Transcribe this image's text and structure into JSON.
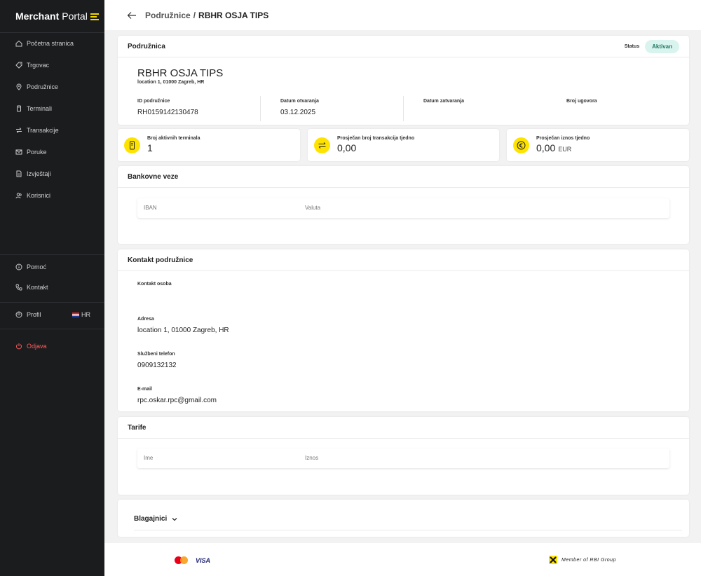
{
  "app": {
    "brand_bold": "Merchant",
    "brand_light": "Portal"
  },
  "sidebar": {
    "items": [
      {
        "label": "Početna stranica",
        "icon": "home-icon"
      },
      {
        "label": "Trgovac",
        "icon": "tag-icon"
      },
      {
        "label": "Podružnice",
        "icon": "location-pin-icon"
      },
      {
        "label": "Terminali",
        "icon": "terminal-icon"
      },
      {
        "label": "Transakcije",
        "icon": "transactions-icon"
      },
      {
        "label": "Poruke",
        "icon": "mail-icon"
      },
      {
        "label": "Izvještaji",
        "icon": "report-icon"
      },
      {
        "label": "Korisnici",
        "icon": "users-icon"
      }
    ],
    "help": "Pomoć",
    "contact": "Kontakt",
    "profile": "Profil",
    "language": "HR",
    "logout": "Odjava"
  },
  "breadcrumb": {
    "parent": "Podružnice",
    "separator": "/",
    "current": "RBHR OSJA TIPS"
  },
  "branch": {
    "section_title": "Podružnica",
    "status_label": "Status",
    "status_value": "Aktivan",
    "name": "RBHR OSJA TIPS",
    "address_short": "location 1, 01000 Zagreb, HR",
    "fields": {
      "id_label": "ID podružnice",
      "id_value": "RH0159142130478",
      "opened_label": "Datum otvaranja",
      "opened_value": "03.12.2025",
      "closed_label": "Datum zatvaranja",
      "closed_value": "",
      "contract_label": "Broj ugovora",
      "contract_value": ""
    }
  },
  "stats": [
    {
      "label": "Broj aktivnih terminala",
      "value": "1",
      "unit": "",
      "icon": "terminal-icon"
    },
    {
      "label": "Prosječan broj transakcija tjedno",
      "value": "0,00",
      "unit": "",
      "icon": "transfer-arrows-icon"
    },
    {
      "label": "Prosječan iznos tjedno",
      "value": "0,00",
      "unit": "EUR",
      "icon": "euro-icon"
    }
  ],
  "bank": {
    "title": "Bankovne veze",
    "columns": [
      "IBAN",
      "Valuta"
    ]
  },
  "contact": {
    "title": "Kontakt podružnice",
    "person_label": "Kontakt osoba",
    "person_value": "",
    "address_label": "Adresa",
    "address_value": "location 1, 01000 Zagreb, HR",
    "phone_label": "Službeni telefon",
    "phone_value": "0909132132",
    "email_label": "E-mail",
    "email_value": "rpc.oskar.rpc@gmail.com"
  },
  "tariffs": {
    "title": "Tarife",
    "columns": [
      "Ime",
      "Iznos"
    ]
  },
  "cashiers": {
    "title": "Blagajnici"
  },
  "footer": {
    "visa": "VISA",
    "rbi": "Member of RBI Group"
  },
  "colors": {
    "accent": "#ffe300",
    "sidebar_bg": "#1b1c1e",
    "logout": "#ff5c5c",
    "badge_bg": "#d9f4ee",
    "badge_text": "#1e7a63"
  }
}
